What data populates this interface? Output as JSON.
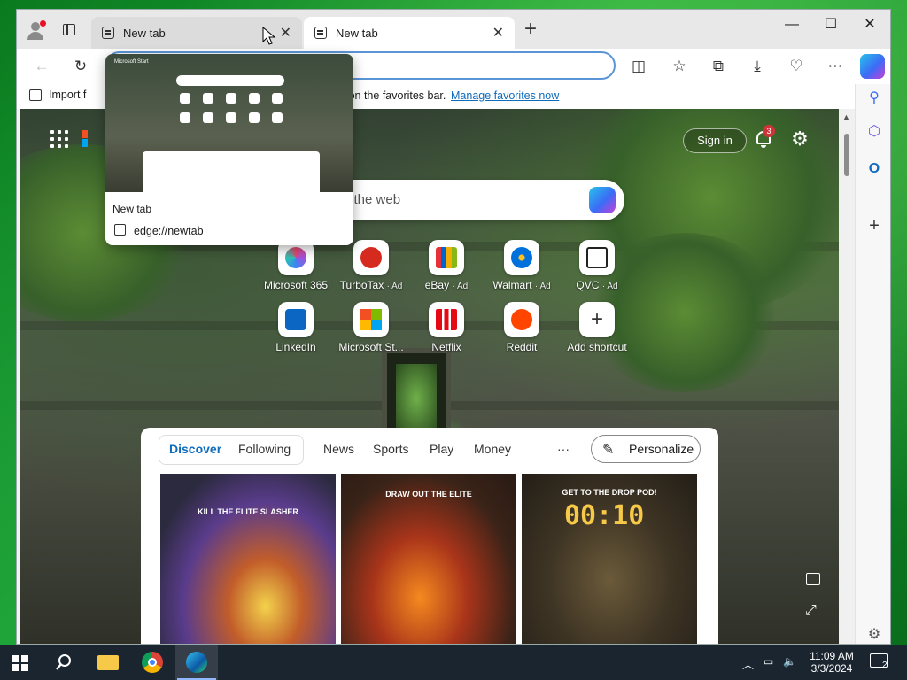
{
  "browser": {
    "tabs": [
      {
        "title": "New tab",
        "state": "hovered"
      },
      {
        "title": "New tab",
        "state": "active"
      }
    ],
    "window_controls": {
      "minimize": "—",
      "maximize": "☐",
      "close": "✕"
    },
    "favorites_bar": {
      "import_label": "Import f",
      "message": "re on the favorites bar.",
      "manage_link": "Manage favorites now"
    }
  },
  "tab_preview": {
    "title": "New tab",
    "url": "edge://newtab",
    "thumb_brand": "Microsoft Start"
  },
  "newtab_page": {
    "signin_label": "Sign in",
    "notification_count": "3",
    "search_placeholder": "h the web",
    "shortcuts": [
      {
        "label": "Microsoft 365",
        "ad": ""
      },
      {
        "label": "TurboTax",
        "ad": "· Ad"
      },
      {
        "label": "eBay",
        "ad": "· Ad"
      },
      {
        "label": "Walmart",
        "ad": "· Ad"
      },
      {
        "label": "QVC",
        "ad": "· Ad"
      },
      {
        "label": "LinkedIn",
        "ad": ""
      },
      {
        "label": "Microsoft St...",
        "ad": ""
      },
      {
        "label": "Netflix",
        "ad": ""
      },
      {
        "label": "Reddit",
        "ad": ""
      },
      {
        "label": "Add shortcut",
        "ad": ""
      }
    ],
    "feed": {
      "tabs": [
        "Discover",
        "Following",
        "News",
        "Sports",
        "Play",
        "Money"
      ],
      "selected_tab": "Discover",
      "more_label": "···",
      "personalize_label": "Personalize",
      "cards": [
        {
          "caption": "KILL THE ELITE SLASHER"
        },
        {
          "caption": "DRAW OUT THE ELITE"
        },
        {
          "caption": "GET TO THE DROP POD!",
          "timer": "00:10"
        }
      ]
    }
  },
  "taskbar": {
    "time": "11:09 AM",
    "date": "3/3/2024",
    "notification_count": "2"
  },
  "colors": {
    "accent": "#0f6cbd",
    "address_focus": "#5b95d6",
    "taskbar": "#1b2530",
    "badge_red": "#d13438"
  }
}
